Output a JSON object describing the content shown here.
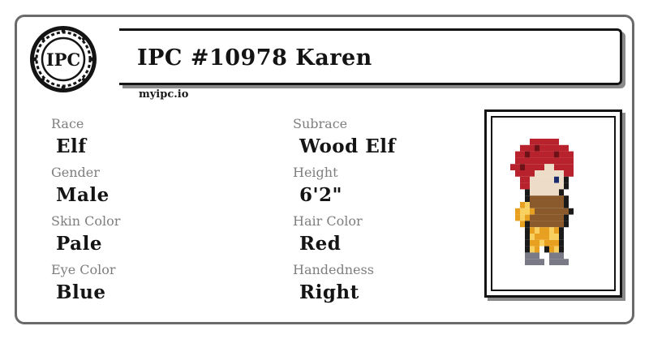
{
  "seal": {
    "text": "IPC"
  },
  "header": {
    "title": "IPC #10978 Karen",
    "site": "myipc.io"
  },
  "attributes": {
    "left": [
      {
        "label": "Race",
        "value": "Elf"
      },
      {
        "label": "Gender",
        "value": "Male"
      },
      {
        "label": "Skin Color",
        "value": "Pale"
      },
      {
        "label": "Eye Color",
        "value": "Blue"
      }
    ],
    "right": [
      {
        "label": "Subrace",
        "value": "Wood Elf"
      },
      {
        "label": "Height",
        "value": "6'2\""
      },
      {
        "label": "Hair Color",
        "value": "Red"
      },
      {
        "label": "Handedness",
        "value": "Right"
      }
    ]
  },
  "colors": {
    "hair": "#b8222c",
    "hair_shadow": "#6e1218",
    "skin": "#ecdcc8",
    "tunic": "#8a5a2c",
    "armor": "#e8a020",
    "armor_light": "#f8d060",
    "boots": "#7a7a86"
  }
}
